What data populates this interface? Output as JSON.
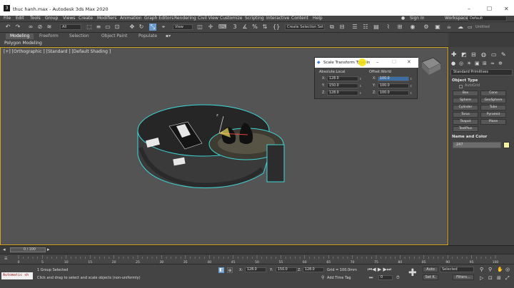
{
  "window": {
    "title": "thuc hanh.max - Autodesk 3ds Max 2020",
    "controls": [
      "–",
      "☐",
      "✕"
    ]
  },
  "menu": [
    "File",
    "Edit",
    "Tools",
    "Group",
    "Views",
    "Create",
    "Modifiers",
    "Animation",
    "Graph Editors",
    "Rendering",
    "Civil View",
    "Customize",
    "Scripting",
    "Interactive",
    "Content",
    "Help"
  ],
  "account": {
    "sign_in": "Sign In",
    "workspaces_label": "Workspaces:",
    "workspaces_value": "Default"
  },
  "toolbar": {
    "filter": "All",
    "view": "View",
    "selection_set": "Create Selection Set",
    "project": "Untitled"
  },
  "ribbon": {
    "tabs": [
      "Modeling",
      "Freeform",
      "Selection",
      "Object Paint",
      "Populate"
    ],
    "sub": "Polygon Modeling"
  },
  "viewport": {
    "label": "[+] [Orthographic ] [Standard ] [Default Shading ]"
  },
  "dialog": {
    "title": "Scale Transform Type-In",
    "absolute_title": "Absolute:Local",
    "offset_title": "Offset:World",
    "abs": {
      "x": "128.0",
      "y": "150.0",
      "z": "128.0"
    },
    "off": {
      "x": "100.0",
      "y": "100.0",
      "z": "100.0"
    },
    "axis": {
      "x": "X:",
      "y": "Y:",
      "z": "Z:"
    }
  },
  "cmdpanel": {
    "category": "Standard Primitives",
    "object_type": "Object Type",
    "autogrid": "AutoGrid",
    "buttons": [
      "Box",
      "Cone",
      "Sphere",
      "GeoSphere",
      "Cylinder",
      "Tube",
      "Torus",
      "Pyramid",
      "Teapot",
      "Plane",
      "TextPlus"
    ],
    "name_color": "Name and Color",
    "name_value": "247"
  },
  "timeline": {
    "frame": "0 / 100",
    "ticks": [
      "0",
      "5",
      "10",
      "15",
      "20",
      "25",
      "30",
      "35",
      "40",
      "45",
      "50",
      "55",
      "60",
      "65",
      "70",
      "75",
      "80",
      "85",
      "90",
      "95",
      "100"
    ]
  },
  "status": {
    "script_box": "Automatic sh",
    "selected": "1 Group Selected",
    "prompt": "Click and drag to select and scale objects (non-uniformly)",
    "x_label": "X:",
    "y_label": "Y:",
    "z_label": "Z:",
    "x": "128.0",
    "y": "150.0",
    "z": "128.0",
    "grid": "Grid = 100.0mm",
    "add_time_tag": "Add Time Tag",
    "auto": "Auto",
    "set_k": "Set K.",
    "selected_dd": "Selected",
    "filters": "Filters...",
    "frame_counter": "0"
  },
  "colors": {
    "accent": "#6a9ccf",
    "selection": "#3fd6d6",
    "viewport_border": "#d4a520",
    "swatch": "#f2f2a0"
  }
}
